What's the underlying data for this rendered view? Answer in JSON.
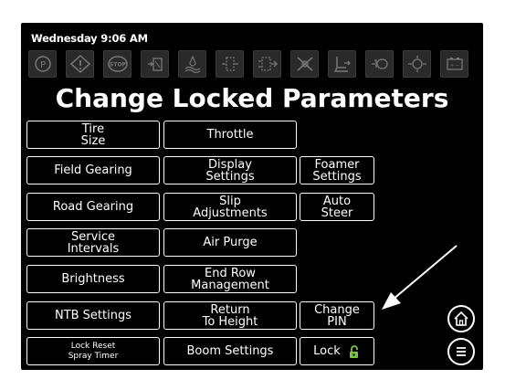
{
  "status": {
    "datetime": "Wednesday 9:06 AM"
  },
  "page": {
    "title": "Change Locked Parameters"
  },
  "toolbar_icons": [
    "parking-brake-icon",
    "warning-icon",
    "stop-icon",
    "fuel-filter-icon",
    "water-in-fuel-icon",
    "transmission-icon",
    "hydraulic-icon",
    "steering-icon",
    "seat-icon",
    "engine-temp-icon",
    "oil-pressure-icon",
    "battery-icon"
  ],
  "toolbar_icon_labels": {
    "stop": "STOP",
    "parking": "P",
    "battery": "+ −"
  },
  "buttons": {
    "tire_size": "Tire\nSize",
    "throttle": "Throttle",
    "field_gearing": "Field Gearing",
    "display_settings": "Display\nSettings",
    "foamer_settings": "Foamer\nSettings",
    "road_gearing": "Road Gearing",
    "slip_adjustments": "Slip\nAdjustments",
    "auto_steer": "Auto\nSteer",
    "service_intervals": "Service\nIntervals",
    "air_purge": "Air Purge",
    "brightness": "Brightness",
    "end_row_management": "End Row\nManagement",
    "ntb_settings": "NTB Settings",
    "return_to_height": "Return\nTo Height",
    "change_pin": "Change\nPIN",
    "lock_reset_spray_timer": "Lock Reset\nSpray Timer",
    "boom_settings": "Boom Settings",
    "lock": "Lock"
  },
  "colors": {
    "lock_icon": "#7dc242",
    "background": "#000000",
    "foreground": "#ffffff"
  }
}
